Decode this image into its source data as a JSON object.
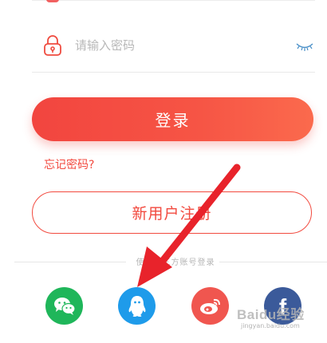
{
  "password": {
    "placeholder": "请输入密码",
    "lock_icon": "lock-icon",
    "toggle_icon": "eye-closed-icon"
  },
  "actions": {
    "login_label": "登录",
    "forgot_label": "忘记密码?",
    "register_label": "新用户注册"
  },
  "third_party": {
    "label": "使用第三方账号登录",
    "providers": [
      {
        "name": "wechat",
        "icon": "wechat-icon",
        "color": "#1fb65a"
      },
      {
        "name": "qq",
        "icon": "qq-icon",
        "color": "#1e9bea"
      },
      {
        "name": "weibo",
        "icon": "weibo-icon",
        "color": "#f0564f"
      },
      {
        "name": "facebook",
        "icon": "facebook-icon",
        "glyph": "f",
        "color": "#3b5a9a"
      }
    ]
  },
  "watermark": {
    "brand": "Baidu经验",
    "url": "jingyan.baidu.com"
  },
  "colors": {
    "accent": "#f24a3f",
    "arrow": "#e8232b"
  }
}
